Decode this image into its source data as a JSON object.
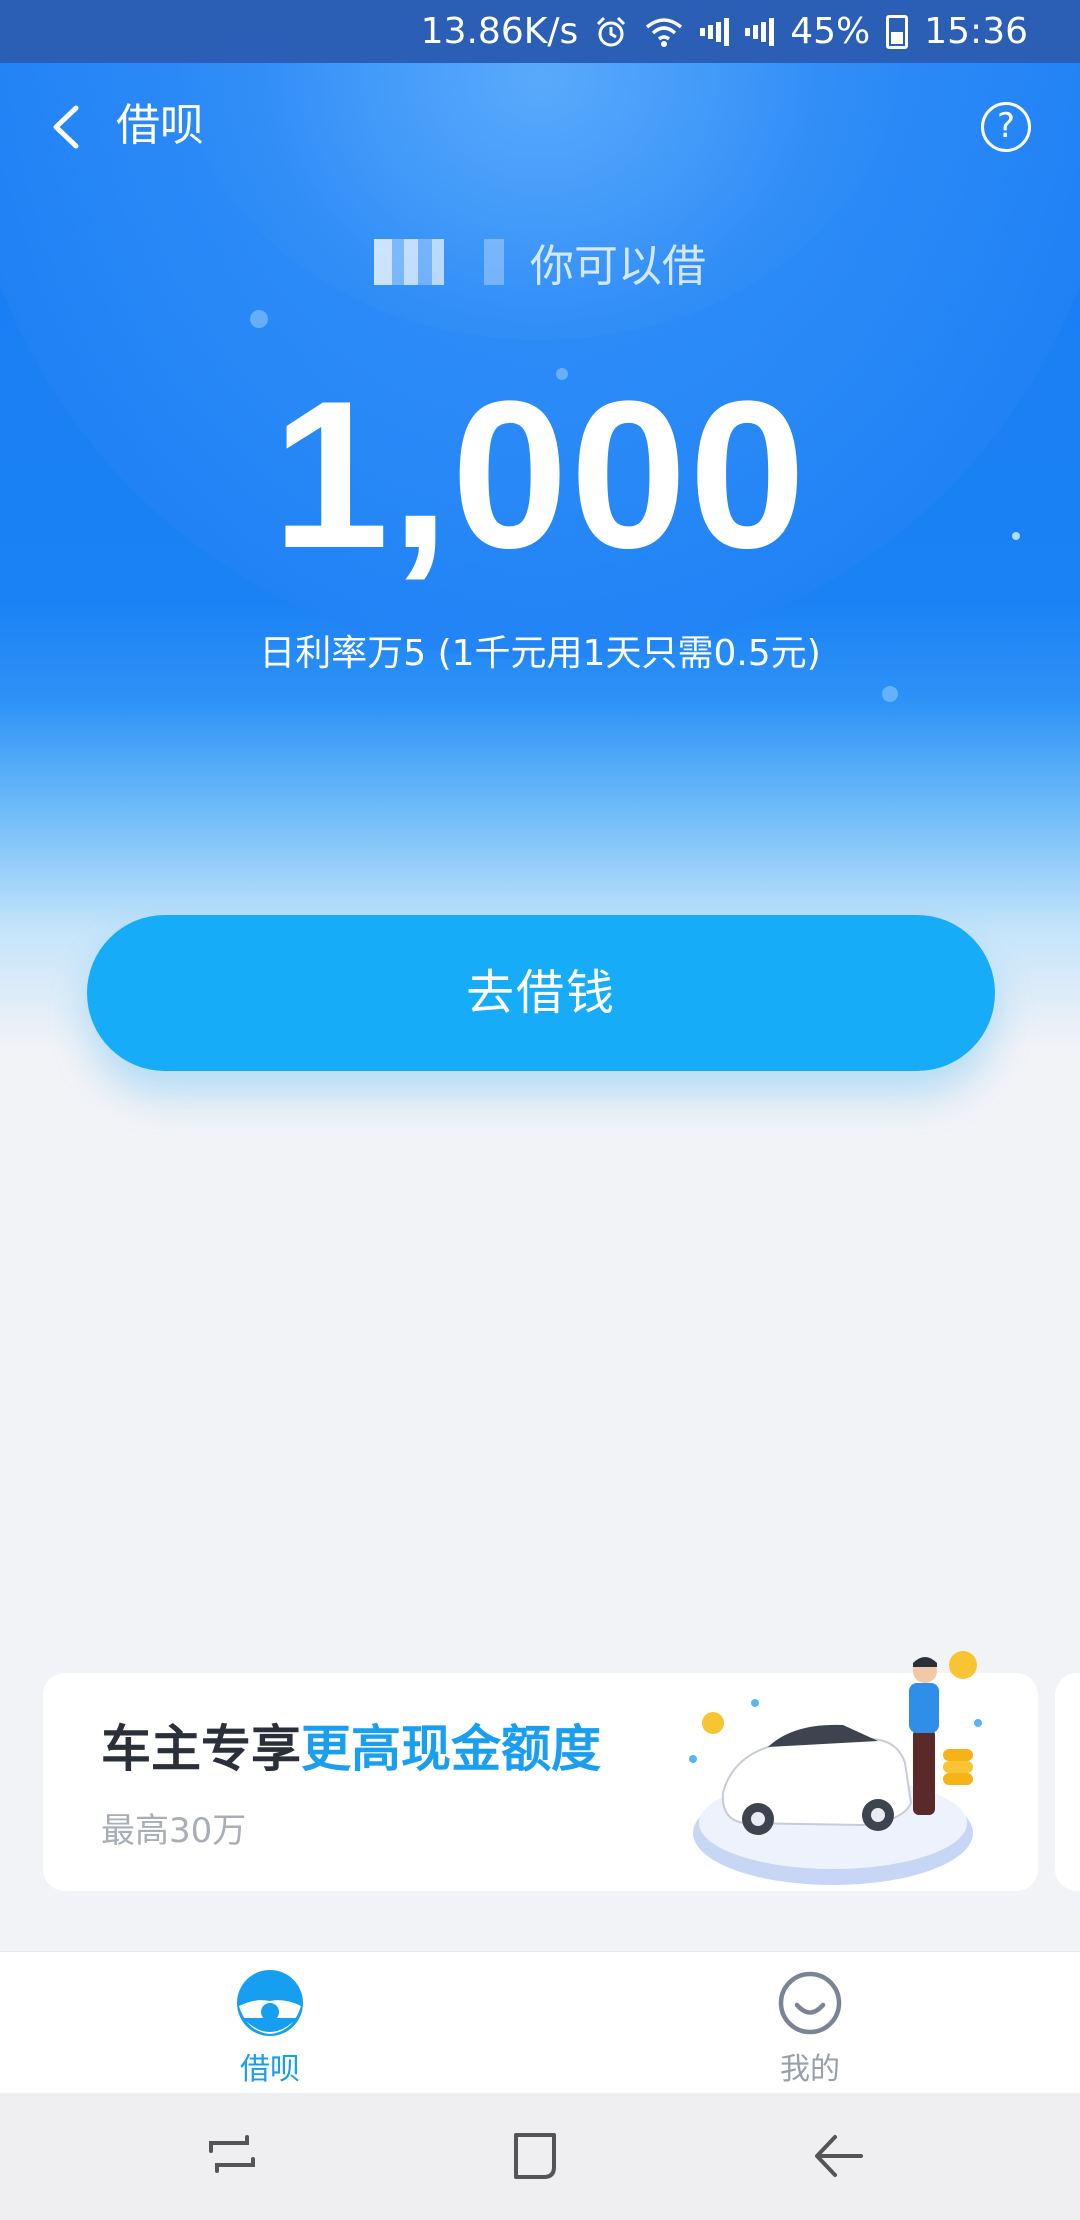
{
  "status_bar": {
    "net_speed": "13.86K/s",
    "battery_percent": "45%",
    "time": "15:36",
    "icons": [
      "alarm-icon",
      "wifi-icon",
      "signal-e-icon",
      "signal-4g-icon",
      "battery-icon"
    ]
  },
  "header": {
    "title": "借呗",
    "back_icon": "chevron-left-icon",
    "help_icon": "question-circle-icon",
    "help_glyph": "?"
  },
  "limit": {
    "caption_suffix": "你可以借",
    "amount": "1,000",
    "rate_text": "日利率万5 (1千元用1天只需0.5元)"
  },
  "borrow_button": {
    "label": "去借钱"
  },
  "promo": {
    "title_plain": "车主专享",
    "title_highlight": "更高现金额度",
    "subtitle": "最高30万",
    "colors": {
      "highlight": "#1a9ef0"
    }
  },
  "tab_bar": {
    "tabs": [
      {
        "label": "借呗",
        "icon": "jiebei-logo-icon",
        "active": true
      },
      {
        "label": "我的",
        "icon": "smiley-icon",
        "active": false
      }
    ]
  },
  "nav_bar": {
    "icons": [
      "recent-apps-icon",
      "home-icon",
      "back-arrow-icon"
    ]
  },
  "colors": {
    "accent": "#17acf7",
    "hero_blue": "#1a7cf3",
    "status_bar": "#2a5fb5",
    "background": "#f2f3f7"
  }
}
